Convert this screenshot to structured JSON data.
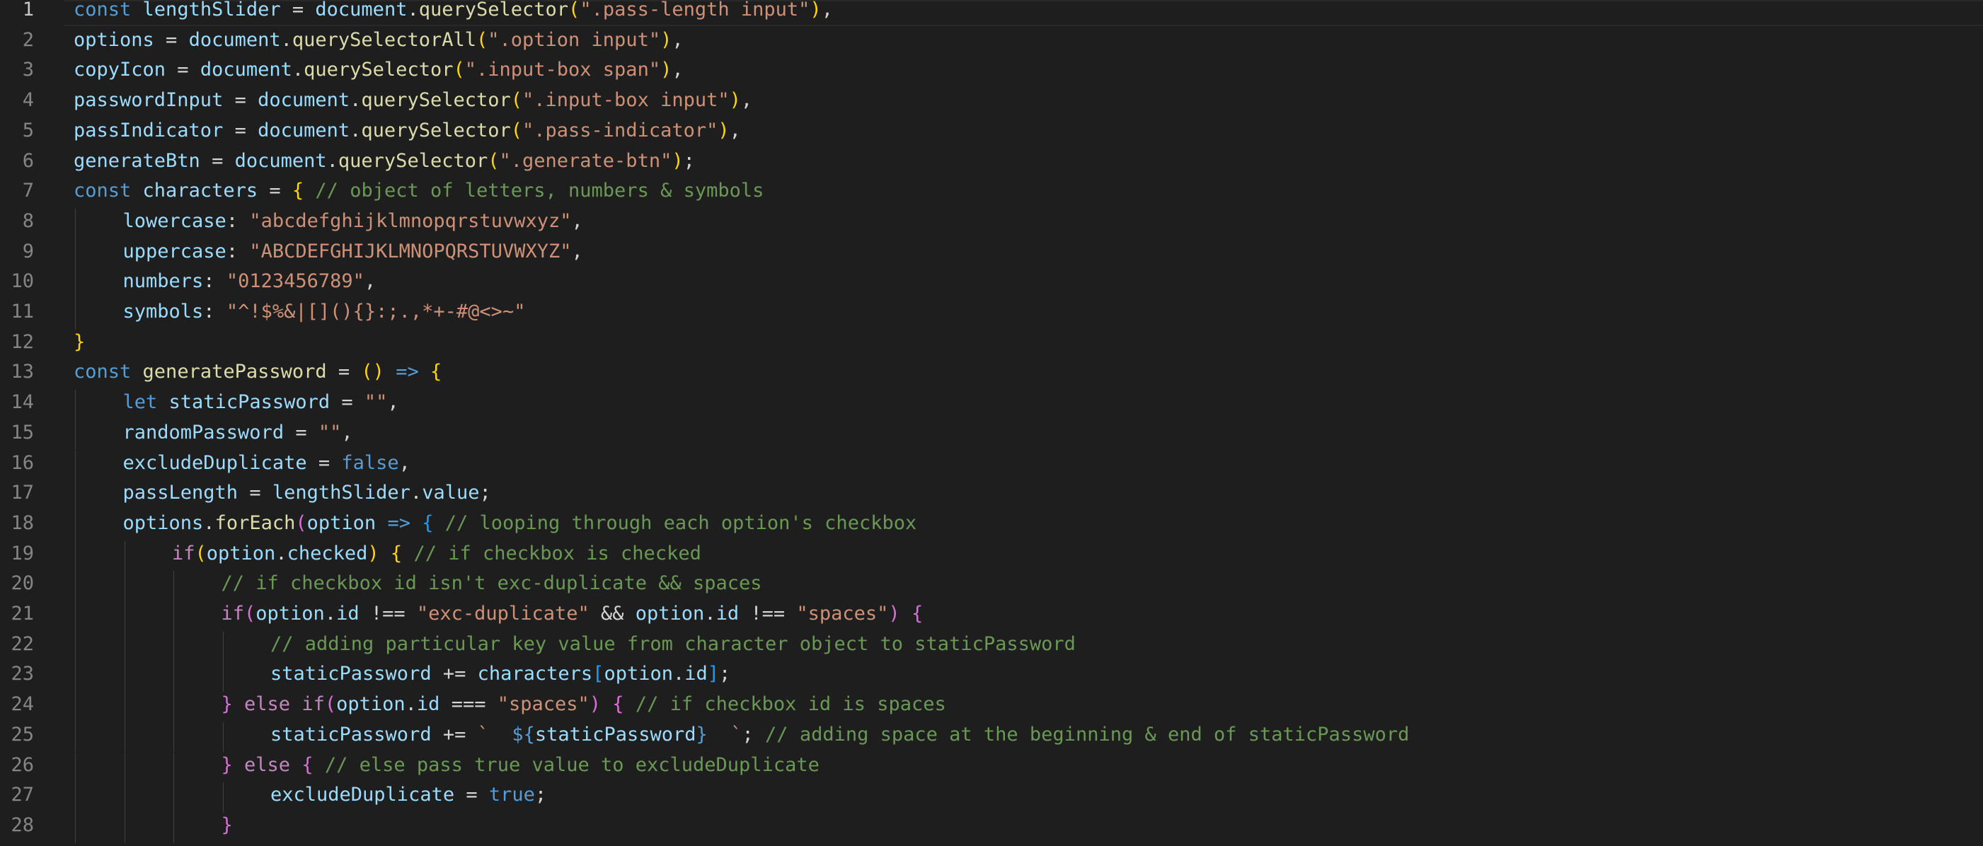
{
  "editor": {
    "language": "javascript",
    "active_line": 1,
    "first_line_number": 1,
    "lines": [
      {
        "n": 1,
        "indent": 0,
        "tokens": [
          [
            "kw",
            "const"
          ],
          [
            "pun",
            " "
          ],
          [
            "var",
            "lengthSlider"
          ],
          [
            "pun",
            " = "
          ],
          [
            "var",
            "document"
          ],
          [
            "pun",
            "."
          ],
          [
            "fn",
            "querySelector"
          ],
          [
            "b1",
            "("
          ],
          [
            "str",
            "\".pass-length input\""
          ],
          [
            "b1",
            ")"
          ],
          [
            "pun",
            ","
          ]
        ]
      },
      {
        "n": 2,
        "indent": 0,
        "tokens": [
          [
            "var",
            "options"
          ],
          [
            "pun",
            " = "
          ],
          [
            "var",
            "document"
          ],
          [
            "pun",
            "."
          ],
          [
            "fn",
            "querySelectorAll"
          ],
          [
            "b1",
            "("
          ],
          [
            "str",
            "\".option input\""
          ],
          [
            "b1",
            ")"
          ],
          [
            "pun",
            ","
          ]
        ]
      },
      {
        "n": 3,
        "indent": 0,
        "tokens": [
          [
            "var",
            "copyIcon"
          ],
          [
            "pun",
            " = "
          ],
          [
            "var",
            "document"
          ],
          [
            "pun",
            "."
          ],
          [
            "fn",
            "querySelector"
          ],
          [
            "b1",
            "("
          ],
          [
            "str",
            "\".input-box span\""
          ],
          [
            "b1",
            ")"
          ],
          [
            "pun",
            ","
          ]
        ]
      },
      {
        "n": 4,
        "indent": 0,
        "tokens": [
          [
            "var",
            "passwordInput"
          ],
          [
            "pun",
            " = "
          ],
          [
            "var",
            "document"
          ],
          [
            "pun",
            "."
          ],
          [
            "fn",
            "querySelector"
          ],
          [
            "b1",
            "("
          ],
          [
            "str",
            "\".input-box input\""
          ],
          [
            "b1",
            ")"
          ],
          [
            "pun",
            ","
          ]
        ]
      },
      {
        "n": 5,
        "indent": 0,
        "tokens": [
          [
            "var",
            "passIndicator"
          ],
          [
            "pun",
            " = "
          ],
          [
            "var",
            "document"
          ],
          [
            "pun",
            "."
          ],
          [
            "fn",
            "querySelector"
          ],
          [
            "b1",
            "("
          ],
          [
            "str",
            "\".pass-indicator\""
          ],
          [
            "b1",
            ")"
          ],
          [
            "pun",
            ","
          ]
        ]
      },
      {
        "n": 6,
        "indent": 0,
        "tokens": [
          [
            "var",
            "generateBtn"
          ],
          [
            "pun",
            " = "
          ],
          [
            "var",
            "document"
          ],
          [
            "pun",
            "."
          ],
          [
            "fn",
            "querySelector"
          ],
          [
            "b1",
            "("
          ],
          [
            "str",
            "\".generate-btn\""
          ],
          [
            "b1",
            ")"
          ],
          [
            "pun",
            ";"
          ]
        ]
      },
      {
        "n": 7,
        "indent": 0,
        "tokens": [
          [
            "kw",
            "const"
          ],
          [
            "pun",
            " "
          ],
          [
            "var",
            "characters"
          ],
          [
            "pun",
            " = "
          ],
          [
            "b1",
            "{"
          ],
          [
            "pun",
            " "
          ],
          [
            "cm",
            "// object of letters, numbers & symbols"
          ]
        ]
      },
      {
        "n": 8,
        "indent": 1,
        "tokens": [
          [
            "var",
            "lowercase"
          ],
          [
            "pun",
            ": "
          ],
          [
            "str",
            "\"abcdefghijklmnopqrstuvwxyz\""
          ],
          [
            "pun",
            ","
          ]
        ]
      },
      {
        "n": 9,
        "indent": 1,
        "tokens": [
          [
            "var",
            "uppercase"
          ],
          [
            "pun",
            ": "
          ],
          [
            "str",
            "\"ABCDEFGHIJKLMNOPQRSTUVWXYZ\""
          ],
          [
            "pun",
            ","
          ]
        ]
      },
      {
        "n": 10,
        "indent": 1,
        "tokens": [
          [
            "var",
            "numbers"
          ],
          [
            "pun",
            ": "
          ],
          [
            "str",
            "\"0123456789\""
          ],
          [
            "pun",
            ","
          ]
        ]
      },
      {
        "n": 11,
        "indent": 1,
        "tokens": [
          [
            "var",
            "symbols"
          ],
          [
            "pun",
            ": "
          ],
          [
            "str",
            "\"^!$%&|[](){}:;.,*+-#@<>~\""
          ]
        ]
      },
      {
        "n": 12,
        "indent": 0,
        "tokens": [
          [
            "b1",
            "}"
          ]
        ]
      },
      {
        "n": 13,
        "indent": 0,
        "tokens": [
          [
            "kw",
            "const"
          ],
          [
            "pun",
            " "
          ],
          [
            "fn",
            "generatePassword"
          ],
          [
            "pun",
            " = "
          ],
          [
            "b1",
            "()"
          ],
          [
            "pun",
            " "
          ],
          [
            "kw",
            "=>"
          ],
          [
            "pun",
            " "
          ],
          [
            "b1",
            "{"
          ]
        ]
      },
      {
        "n": 14,
        "indent": 1,
        "tokens": [
          [
            "kw",
            "let"
          ],
          [
            "pun",
            " "
          ],
          [
            "var",
            "staticPassword"
          ],
          [
            "pun",
            " = "
          ],
          [
            "str",
            "\"\""
          ],
          [
            "pun",
            ","
          ]
        ]
      },
      {
        "n": 15,
        "indent": 1,
        "tokens": [
          [
            "var",
            "randomPassword"
          ],
          [
            "pun",
            " = "
          ],
          [
            "str",
            "\"\""
          ],
          [
            "pun",
            ","
          ]
        ]
      },
      {
        "n": 16,
        "indent": 1,
        "tokens": [
          [
            "var",
            "excludeDuplicate"
          ],
          [
            "pun",
            " = "
          ],
          [
            "kw",
            "false"
          ],
          [
            "pun",
            ","
          ]
        ]
      },
      {
        "n": 17,
        "indent": 1,
        "tokens": [
          [
            "var",
            "passLength"
          ],
          [
            "pun",
            " = "
          ],
          [
            "var",
            "lengthSlider"
          ],
          [
            "pun",
            "."
          ],
          [
            "var",
            "value"
          ],
          [
            "pun",
            ";"
          ]
        ]
      },
      {
        "n": 18,
        "indent": 1,
        "tokens": [
          [
            "var",
            "options"
          ],
          [
            "pun",
            "."
          ],
          [
            "fn",
            "forEach"
          ],
          [
            "b2",
            "("
          ],
          [
            "var",
            "option"
          ],
          [
            "pun",
            " "
          ],
          [
            "kw",
            "=>"
          ],
          [
            "pun",
            " "
          ],
          [
            "b3",
            "{"
          ],
          [
            "pun",
            " "
          ],
          [
            "cm",
            "// looping through each option's checkbox"
          ]
        ]
      },
      {
        "n": 19,
        "indent": 2,
        "tokens": [
          [
            "cf",
            "if"
          ],
          [
            "b1",
            "("
          ],
          [
            "var",
            "option"
          ],
          [
            "pun",
            "."
          ],
          [
            "var",
            "checked"
          ],
          [
            "b1",
            ")"
          ],
          [
            "pun",
            " "
          ],
          [
            "b1",
            "{"
          ],
          [
            "pun",
            " "
          ],
          [
            "cm",
            "// if checkbox is checked"
          ]
        ]
      },
      {
        "n": 20,
        "indent": 3,
        "tokens": [
          [
            "cm",
            "// if checkbox id isn't exc-duplicate && spaces"
          ]
        ]
      },
      {
        "n": 21,
        "indent": 3,
        "tokens": [
          [
            "cf",
            "if"
          ],
          [
            "b2",
            "("
          ],
          [
            "var",
            "option"
          ],
          [
            "pun",
            "."
          ],
          [
            "var",
            "id"
          ],
          [
            "pun",
            " !== "
          ],
          [
            "str",
            "\"exc-duplicate\""
          ],
          [
            "pun",
            " && "
          ],
          [
            "var",
            "option"
          ],
          [
            "pun",
            "."
          ],
          [
            "var",
            "id"
          ],
          [
            "pun",
            " !== "
          ],
          [
            "str",
            "\"spaces\""
          ],
          [
            "b2",
            ")"
          ],
          [
            "pun",
            " "
          ],
          [
            "b2",
            "{"
          ]
        ]
      },
      {
        "n": 22,
        "indent": 4,
        "tokens": [
          [
            "cm",
            "// adding particular key value from character object to staticPassword"
          ]
        ]
      },
      {
        "n": 23,
        "indent": 4,
        "tokens": [
          [
            "var",
            "staticPassword"
          ],
          [
            "pun",
            " += "
          ],
          [
            "var",
            "characters"
          ],
          [
            "b3",
            "["
          ],
          [
            "var",
            "option"
          ],
          [
            "pun",
            "."
          ],
          [
            "var",
            "id"
          ],
          [
            "b3",
            "]"
          ],
          [
            "pun",
            ";"
          ]
        ]
      },
      {
        "n": 24,
        "indent": 3,
        "tokens": [
          [
            "b2",
            "}"
          ],
          [
            "pun",
            " "
          ],
          [
            "cf",
            "else"
          ],
          [
            "pun",
            " "
          ],
          [
            "cf",
            "if"
          ],
          [
            "b2",
            "("
          ],
          [
            "var",
            "option"
          ],
          [
            "pun",
            "."
          ],
          [
            "var",
            "id"
          ],
          [
            "pun",
            " === "
          ],
          [
            "str",
            "\"spaces\""
          ],
          [
            "b2",
            ")"
          ],
          [
            "pun",
            " "
          ],
          [
            "b2",
            "{"
          ],
          [
            "pun",
            " "
          ],
          [
            "cm",
            "// if checkbox id is spaces"
          ]
        ]
      },
      {
        "n": 25,
        "indent": 4,
        "tokens": [
          [
            "var",
            "staticPassword"
          ],
          [
            "pun",
            " += "
          ],
          [
            "str",
            "`  "
          ],
          [
            "kw",
            "${"
          ],
          [
            "var",
            "staticPassword"
          ],
          [
            "kw",
            "}"
          ],
          [
            "str",
            "  `"
          ],
          [
            "pun",
            "; "
          ],
          [
            "cm",
            "// adding space at the beginning & end of staticPassword"
          ]
        ]
      },
      {
        "n": 26,
        "indent": 3,
        "tokens": [
          [
            "b2",
            "}"
          ],
          [
            "pun",
            " "
          ],
          [
            "cf",
            "else"
          ],
          [
            "pun",
            " "
          ],
          [
            "b2",
            "{"
          ],
          [
            "pun",
            " "
          ],
          [
            "cm",
            "// else pass true value to excludeDuplicate"
          ]
        ]
      },
      {
        "n": 27,
        "indent": 4,
        "tokens": [
          [
            "var",
            "excludeDuplicate"
          ],
          [
            "pun",
            " = "
          ],
          [
            "kw",
            "true"
          ],
          [
            "pun",
            ";"
          ]
        ]
      },
      {
        "n": 28,
        "indent": 3,
        "tokens": [
          [
            "b2",
            "}"
          ]
        ]
      }
    ]
  }
}
